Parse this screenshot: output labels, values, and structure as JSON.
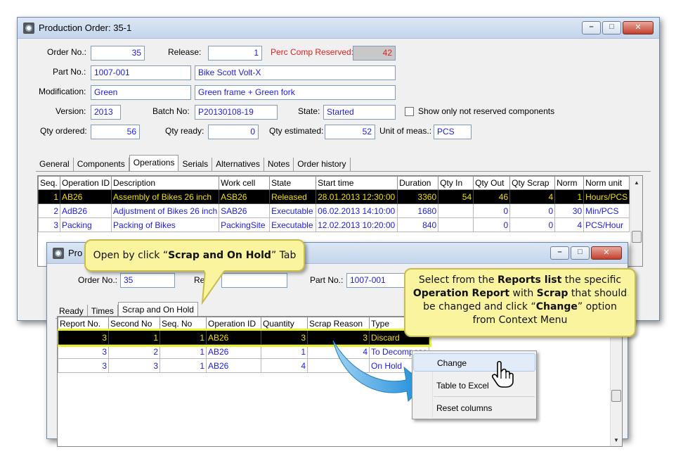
{
  "main": {
    "title": "Production Order: 35-1",
    "labels": {
      "order_no": "Order No.:",
      "release": "Release:",
      "perc_comp": "Perc Comp Reserved:",
      "part_no": "Part No.:",
      "modification": "Modification:",
      "version": "Version:",
      "batch_no": "Batch No:",
      "state": "State:",
      "show_only": "Show only not reserved components",
      "qty_ordered": "Qty ordered:",
      "qty_ready": "Qty ready:",
      "qty_estimated": "Qty estimated:",
      "unit_of_meas": "Unit of meas.:"
    },
    "values": {
      "order_no": "35",
      "release": "1",
      "perc_comp": "42",
      "part_no": "1007-001",
      "part_desc": "Bike Scott Volt-X",
      "modification": "Green",
      "modification_desc": "Green frame + Green fork",
      "version": "2013",
      "batch_no": "P20130108-19",
      "state": "Started",
      "qty_ordered": "56",
      "qty_ready": "0",
      "qty_estimated": "52",
      "unit_of_meas": "PCS"
    },
    "tabs": [
      "General",
      "Components",
      "Operations",
      "Serials",
      "Alternatives",
      "Notes",
      "Order history"
    ],
    "active_tab": "Operations",
    "columns": [
      "Seq.",
      "Operation ID",
      "Description",
      "Work cell",
      "State",
      "Start time",
      "Duration",
      "Qty In",
      "Qty Out",
      "Qty Scrap",
      "Norm",
      "Norm unit"
    ],
    "rows": [
      [
        "1",
        "AB26",
        "Assembly of Bikes 26 inch",
        "ASB26",
        "Released",
        "28.01.2013 12:30:00",
        "3360",
        "54",
        "46",
        "4",
        "1",
        "Hours/PCS"
      ],
      [
        "2",
        "AdB26",
        "Adjustment of Bikes 26 inch",
        "SAB26",
        "Executable",
        "06.02.2013 14:10:00",
        "1680",
        "",
        "0",
        "0",
        "30",
        "Min/PCS"
      ],
      [
        "3",
        "Packing",
        "Packing of Bikes",
        "PackingSite",
        "Executable",
        "12.02.2013 10:20:00",
        "840",
        "",
        "0",
        "0",
        "4",
        "PCS/Hour"
      ]
    ]
  },
  "sub": {
    "title": "Pro",
    "labels": {
      "order_no": "Order No.:",
      "release": "Rele",
      "part_no": "Part No.:"
    },
    "values": {
      "order_no": "35",
      "part_no": "1007-001"
    },
    "tabs": [
      "Ready",
      "Times",
      "Scrap and On Hold"
    ],
    "active_tab": "Scrap and On Hold",
    "columns": [
      "Report No.",
      "Second No",
      "Seq. No",
      "Operation ID",
      "Quantity",
      "Scrap Reason",
      "Type"
    ],
    "rows": [
      [
        "3",
        "1",
        "1",
        "AB26",
        "3",
        "3",
        "Discard"
      ],
      [
        "3",
        "2",
        "1",
        "AB26",
        "1",
        "4",
        "To Decompose"
      ],
      [
        "3",
        "3",
        "1",
        "AB26",
        "4",
        "",
        "On Hold"
      ]
    ]
  },
  "context_menu": {
    "items": [
      "Change",
      "Table to Excel",
      "Reset columns"
    ],
    "highlighted": "Change"
  },
  "callouts": {
    "tab_hint": {
      "prefix": "Open by click “",
      "bold": "Scrap and On Hold",
      "suffix": "” Tab"
    },
    "report_hint": {
      "p1": "Select from the ",
      "b1": "Reports list",
      "p2": " the specific ",
      "b2": "Operation Report",
      "p3": " with ",
      "b3": "Scrap",
      "p4": " that should be changed and click “",
      "b4": "Change",
      "p5": "” option from Context Menu"
    }
  },
  "window_buttons": {
    "minimize": "–",
    "maximize": "□",
    "close": "✕"
  },
  "colors": {
    "selection_bg": "#000000",
    "selection_fg": "#f0e000",
    "field_text": "#1c1ce0",
    "callout_bg": "#fbf49e",
    "arrow": "#2aa0e0"
  }
}
